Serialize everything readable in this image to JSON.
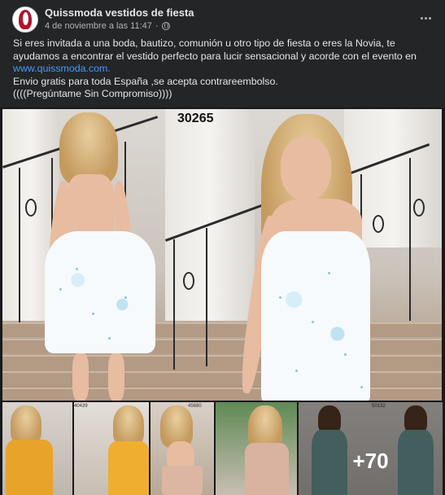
{
  "post": {
    "page_name": "Quissmoda vestidos de fiesta",
    "timestamp": "4 de noviembre a las 11:47",
    "separator": "·",
    "privacy_icon": "globe-icon",
    "more_icon": "more-horizontal-icon",
    "text_line1": "Si eres invitada a una boda, bautizo, comunión u otro tipo de fiesta o eres la Novia, te ayudamos a encontrar el vestido perfecto para lucir sensacional y acorde con el evento en",
    "link": "www.quissmoda.com.",
    "text_line2": "Envio gratis para toda España ,se acepta contrareembolso.",
    "text_line3": "((((Pregúntame Sin Compromiso))))"
  },
  "media": {
    "main_code": "30265",
    "thumbs": [
      {
        "code": "40439"
      },
      {
        "code": ""
      },
      {
        "code": "45680"
      },
      {
        "code": ""
      },
      {
        "code": "50132"
      }
    ],
    "more_count": "+70"
  },
  "colors": {
    "background": "#242526",
    "text": "#e4e6eb",
    "secondary_text": "#b0b3b8",
    "link": "#4599ff"
  }
}
